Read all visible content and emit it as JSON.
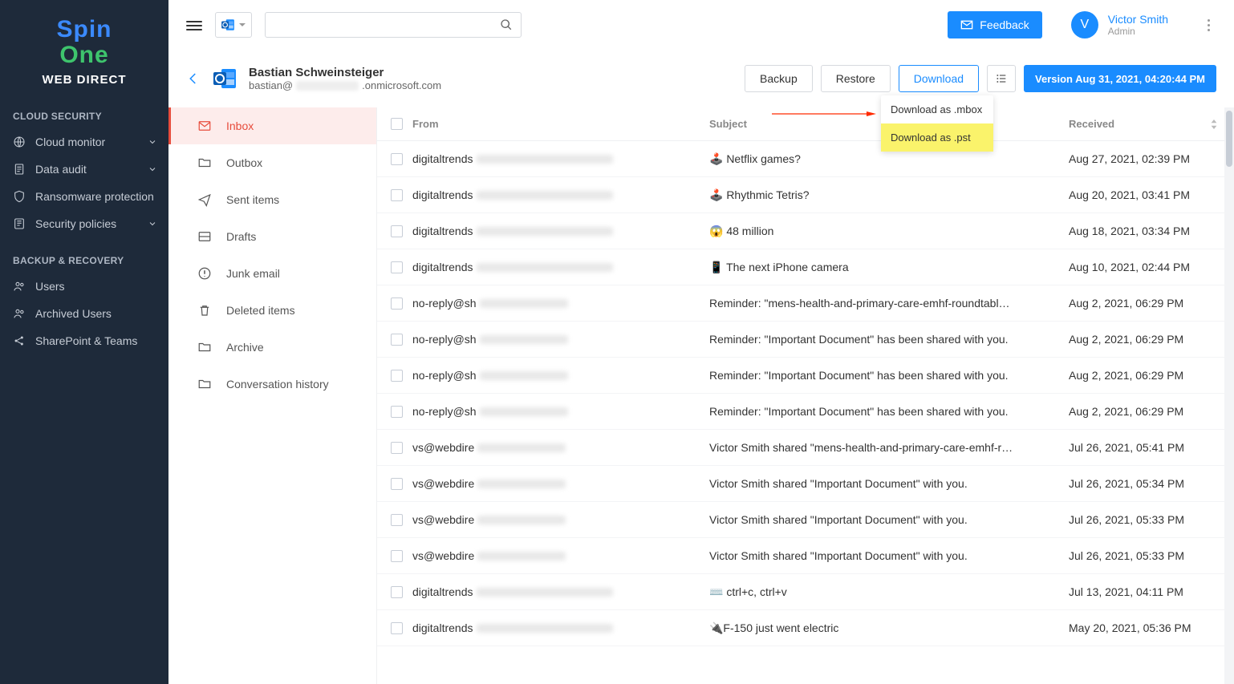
{
  "logo": {
    "spin": "Spin",
    "one": "One",
    "wd": "WEB DIRECT"
  },
  "sidebar": {
    "section1": "CLOUD SECURITY",
    "items1": [
      {
        "label": "Cloud monitor",
        "chev": true
      },
      {
        "label": "Data audit",
        "chev": true
      },
      {
        "label": "Ransomware protection",
        "chev": false
      },
      {
        "label": "Security policies",
        "chev": true
      }
    ],
    "section2": "BACKUP & RECOVERY",
    "items2": [
      {
        "label": "Users"
      },
      {
        "label": "Archived Users"
      },
      {
        "label": "SharePoint & Teams"
      }
    ]
  },
  "topbar": {
    "feedback": "Feedback",
    "profile_initial": "V",
    "profile_name": "Victor Smith",
    "profile_role": "Admin"
  },
  "account": {
    "name": "Bastian Schweinsteiger",
    "email_prefix": "bastian@",
    "email_suffix": ".onmicrosoft.com",
    "backup": "Backup",
    "restore": "Restore",
    "download": "Download",
    "version": "Version Aug 31, 2021, 04:20:44 PM",
    "dd_mbox": "Download as .mbox",
    "dd_pst": "Download as .pst"
  },
  "folders": [
    {
      "label": "Inbox",
      "icon": "inbox",
      "active": true
    },
    {
      "label": "Outbox",
      "icon": "folder"
    },
    {
      "label": "Sent items",
      "icon": "send"
    },
    {
      "label": "Drafts",
      "icon": "draft"
    },
    {
      "label": "Junk email",
      "icon": "junk"
    },
    {
      "label": "Deleted items",
      "icon": "trash"
    },
    {
      "label": "Archive",
      "icon": "folder"
    },
    {
      "label": "Conversation history",
      "icon": "folder"
    }
  ],
  "columns": {
    "from": "From",
    "subject": "Subject",
    "received": "Received"
  },
  "mails": [
    {
      "from": "digitaltrends",
      "ft": "a",
      "subject": "🕹️ Netflix games?",
      "date": "Aug 27, 2021, 02:39 PM"
    },
    {
      "from": "digitaltrends",
      "ft": "a",
      "subject": "🕹️ Rhythmic Tetris?",
      "date": "Aug 20, 2021, 03:41 PM"
    },
    {
      "from": "digitaltrends",
      "ft": "a",
      "subject": "😱 48 million",
      "date": "Aug 18, 2021, 03:34 PM"
    },
    {
      "from": "digitaltrends",
      "ft": "a",
      "subject": "📱 The next iPhone camera",
      "date": "Aug 10, 2021, 02:44 PM"
    },
    {
      "from": "no-reply@sh",
      "ft": "b",
      "subject": "Reminder: \"mens-health-and-primary-care-emhf-roundtabl…",
      "date": "Aug 2, 2021, 06:29 PM"
    },
    {
      "from": "no-reply@sh",
      "ft": "b",
      "subject": "Reminder: \"Important Document\" has been shared with you.",
      "date": "Aug 2, 2021, 06:29 PM"
    },
    {
      "from": "no-reply@sh",
      "ft": "b",
      "subject": "Reminder: \"Important Document\" has been shared with you.",
      "date": "Aug 2, 2021, 06:29 PM"
    },
    {
      "from": "no-reply@sh",
      "ft": "b",
      "subject": "Reminder: \"Important Document\" has been shared with you.",
      "date": "Aug 2, 2021, 06:29 PM"
    },
    {
      "from": "vs@webdire",
      "ft": "b",
      "subject": "Victor Smith shared \"mens-health-and-primary-care-emhf-r…",
      "date": "Jul 26, 2021, 05:41 PM"
    },
    {
      "from": "vs@webdire",
      "ft": "b",
      "subject": "Victor Smith shared \"Important Document\" with you.",
      "date": "Jul 26, 2021, 05:34 PM"
    },
    {
      "from": "vs@webdire",
      "ft": "b",
      "subject": "Victor Smith shared \"Important Document\" with you.",
      "date": "Jul 26, 2021, 05:33 PM"
    },
    {
      "from": "vs@webdire",
      "ft": "b",
      "subject": "Victor Smith shared \"Important Document\" with you.",
      "date": "Jul 26, 2021, 05:33 PM"
    },
    {
      "from": "digitaltrends",
      "ft": "a",
      "subject": "⌨️ ctrl+c, ctrl+v",
      "date": "Jul 13, 2021, 04:11 PM"
    },
    {
      "from": "digitaltrends",
      "ft": "a",
      "subject": "🔌F-150 just went electric",
      "date": "May 20, 2021, 05:36 PM"
    }
  ]
}
